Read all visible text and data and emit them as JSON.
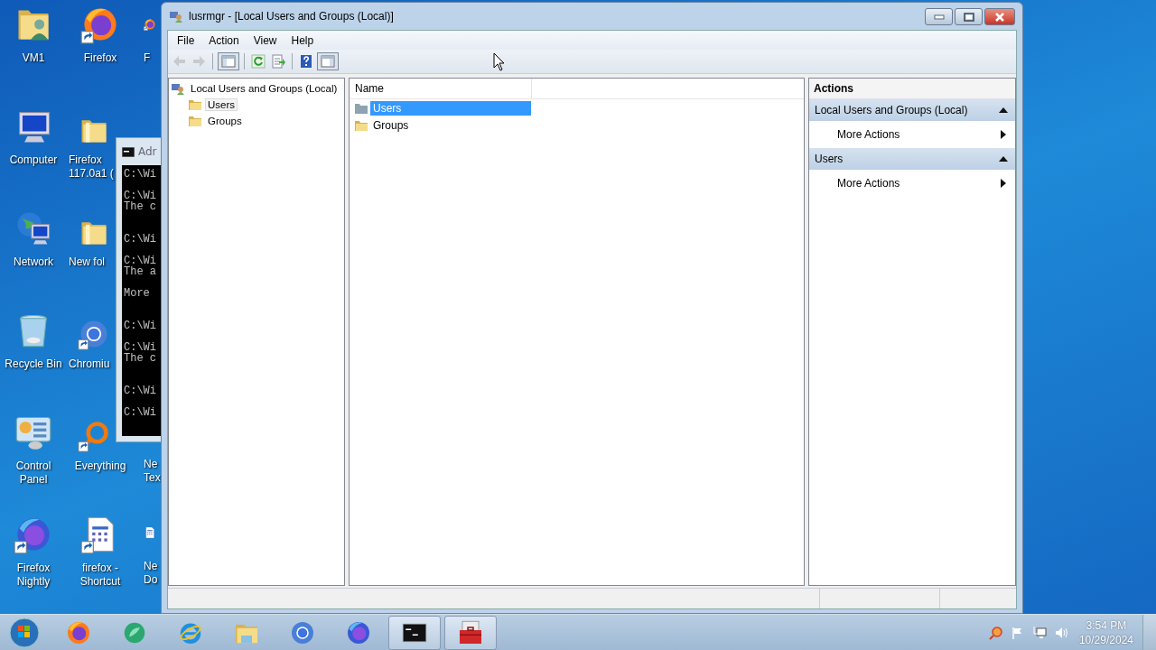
{
  "desktop": {
    "columns": [
      [
        {
          "label": "VM1",
          "kind": "user-folder",
          "shortcut": false
        },
        {
          "label": "Computer",
          "kind": "computer",
          "shortcut": false
        },
        {
          "label": "Network",
          "kind": "network",
          "shortcut": false
        },
        {
          "label": "Recycle Bin",
          "kind": "recycle-bin",
          "shortcut": false
        },
        {
          "label": "Control Panel",
          "kind": "control-panel",
          "shortcut": false
        },
        {
          "label": "Firefox Nightly",
          "kind": "firefox-nightly",
          "shortcut": true
        }
      ],
      [
        {
          "label": "Firefox",
          "kind": "firefox",
          "shortcut": true
        },
        {
          "label": "Firefox 117.0a1 (",
          "kind": "folder",
          "shortcut": false
        },
        {
          "label": "New fol",
          "kind": "folder",
          "shortcut": false
        },
        {
          "label": "Chromiu",
          "kind": "chromium",
          "shortcut": true
        },
        {
          "label": "Everything",
          "kind": "everything",
          "shortcut": true
        },
        {
          "label": "firefox - Shortcut",
          "kind": "document",
          "shortcut": true
        }
      ],
      [
        {
          "label": "F",
          "kind": "firefox",
          "shortcut": true
        },
        {
          "label": "Ne Tex"
        },
        {
          "label": "Ne Do",
          "kind": "document",
          "shortcut": false
        }
      ]
    ]
  },
  "console": {
    "title": "Adr",
    "lines": [
      {
        "text": "C:\\Wi",
        "kind": "next"
      },
      {
        "text": "C:\\Wi",
        "kind": "gap"
      },
      {
        "text": "The c",
        "kind": "next"
      },
      {
        "text": "C:\\Wi",
        "kind": "wide-gap"
      },
      {
        "text": "C:\\Wi",
        "kind": "gap"
      },
      {
        "text": "The a",
        "kind": "next"
      },
      {
        "text": "More",
        "kind": "gap"
      },
      {
        "text": "C:\\Wi",
        "kind": "wide-gap"
      },
      {
        "text": "C:\\Wi",
        "kind": "gap"
      },
      {
        "text": "The c",
        "kind": "next"
      },
      {
        "text": "C:\\Wi",
        "kind": "wide-gap"
      },
      {
        "text": "C:\\Wi",
        "kind": "gap"
      }
    ]
  },
  "window": {
    "title": "lusrmgr - [Local Users and Groups (Local)]",
    "menu": [
      "File",
      "Action",
      "View",
      "Help"
    ],
    "toolbar": [
      {
        "kind": "back",
        "disabled": true,
        "pressed": false
      },
      {
        "kind": "forward",
        "disabled": true,
        "pressed": false
      },
      {
        "kind": "separator"
      },
      {
        "kind": "tree",
        "disabled": false,
        "pressed": true
      },
      {
        "kind": "separator"
      },
      {
        "kind": "refresh",
        "disabled": false,
        "pressed": false
      },
      {
        "kind": "export",
        "disabled": false,
        "pressed": false
      },
      {
        "kind": "separator"
      },
      {
        "kind": "help",
        "disabled": false,
        "pressed": false
      },
      {
        "kind": "actionpane",
        "disabled": false,
        "pressed": true
      }
    ],
    "tree": {
      "label": "Local Users and Groups (Local)",
      "selected": false,
      "children": [
        {
          "label": "Users",
          "selected": true
        },
        {
          "label": "Groups",
          "selected": false
        }
      ]
    },
    "list": {
      "columns": [
        "Name"
      ],
      "rows": [
        {
          "name": "Users",
          "selected": true
        },
        {
          "name": "Groups",
          "selected": false
        }
      ]
    },
    "actions": {
      "title": "Actions",
      "sections": [
        {
          "title": "Local Users and Groups (Local)",
          "expanded": true,
          "items": [
            "More Actions"
          ]
        },
        {
          "title": "Users",
          "expanded": true,
          "items": [
            "More Actions"
          ]
        }
      ]
    }
  },
  "taskbar": {
    "items": [
      {
        "kind": "firefox",
        "open": false
      },
      {
        "kind": "green-app",
        "open": false
      },
      {
        "kind": "ie",
        "open": false
      },
      {
        "kind": "explorer",
        "open": false
      },
      {
        "kind": "chromium",
        "open": false
      },
      {
        "kind": "firefox-nightly",
        "open": false
      },
      {
        "kind": "console",
        "open": true
      },
      {
        "kind": "toolbox",
        "open": true
      }
    ],
    "tray": {
      "time": "3:54 PM",
      "date": "10/29/2024"
    }
  }
}
